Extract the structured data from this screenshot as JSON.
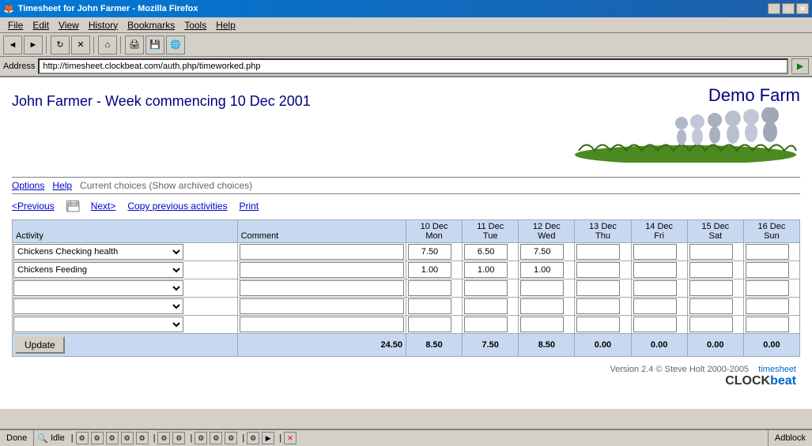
{
  "window": {
    "title": "Timesheet for John Farmer - Mozilla Firefox"
  },
  "menubar": {
    "items": [
      "File",
      "Edit",
      "View",
      "History",
      "Bookmarks",
      "Tools",
      "Help"
    ]
  },
  "toolbar": {
    "back_label": "◄",
    "forward_label": "►",
    "reload_label": "↻",
    "stop_label": "✕",
    "home_label": "⌂",
    "print_label": "🖨",
    "address_label": "Address",
    "url": "http://timesheet.clockbeat.com/auth.php/timeworked.php",
    "go_label": "▶"
  },
  "header": {
    "title": "John Farmer - Week commencing 10 Dec 2001",
    "farm_name": "Demo Farm"
  },
  "nav": {
    "options_label": "Options",
    "help_label": "Help",
    "current_choices_text": "Current choices (Show archived choices)"
  },
  "actions": {
    "prev_label": "<Previous",
    "next_label": "Next>",
    "copy_label": "Copy previous activities",
    "print_label": "Print"
  },
  "table": {
    "columns": [
      {
        "label": "Activity",
        "key": "activity"
      },
      {
        "label": "Comment",
        "key": "comment"
      },
      {
        "label": "10 Dec\nMon",
        "key": "mon"
      },
      {
        "label": "11 Dec\nTue",
        "key": "tue"
      },
      {
        "label": "12 Dec\nWed",
        "key": "wed"
      },
      {
        "label": "13 Dec\nThu",
        "key": "thu"
      },
      {
        "label": "14 Dec\nFri",
        "key": "fri"
      },
      {
        "label": "15 Dec\nSat",
        "key": "sat"
      },
      {
        "label": "16 Dec\nSun",
        "key": "sun"
      }
    ],
    "rows": [
      {
        "activity": "Chickens Checking health",
        "comment": "",
        "mon": "7.50",
        "tue": "6.50",
        "wed": "7.50",
        "thu": "",
        "fri": "",
        "sat": "",
        "sun": ""
      },
      {
        "activity": "Chickens Feeding",
        "comment": "",
        "mon": "1.00",
        "tue": "1.00",
        "wed": "1.00",
        "thu": "",
        "fri": "",
        "sat": "",
        "sun": ""
      },
      {
        "activity": "",
        "comment": "",
        "mon": "",
        "tue": "",
        "wed": "",
        "thu": "",
        "fri": "",
        "sat": "",
        "sun": ""
      },
      {
        "activity": "",
        "comment": "",
        "mon": "",
        "tue": "",
        "wed": "",
        "thu": "",
        "fri": "",
        "sat": "",
        "sun": ""
      },
      {
        "activity": "",
        "comment": "",
        "mon": "",
        "tue": "",
        "wed": "",
        "thu": "",
        "fri": "",
        "sat": "",
        "sun": ""
      }
    ],
    "totals": {
      "label": "",
      "total": "24.50",
      "mon": "8.50",
      "tue": "7.50",
      "wed": "8.50",
      "thu": "0.00",
      "fri": "0.00",
      "sat": "0.00",
      "sun": "0.00"
    },
    "update_btn": "Update"
  },
  "footer": {
    "version_text": "Version 2.4 © Steve Holt 2000-2005",
    "clockbeat_label": "timesheet\nCLOCKbeat"
  },
  "statusbar": {
    "status_text": "Done",
    "idle_label": "Idle",
    "adblock_label": "Adblock"
  }
}
